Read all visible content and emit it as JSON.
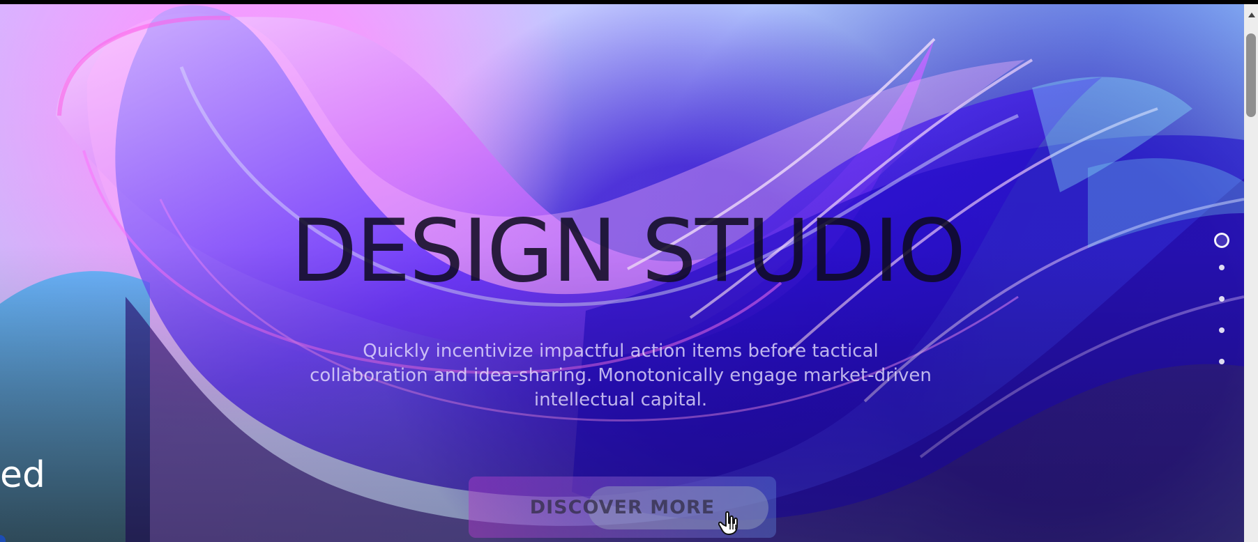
{
  "hero": {
    "title": "DESIGN STUDIO",
    "subtitle": "Quickly incentivize impactful action items before tactical collaboration and idea-sharing. Monotonically engage market-driven intellectual capital.",
    "cta_label": "DISCOVER MORE"
  },
  "sidebar": {
    "partial_text": "ed"
  },
  "slider": {
    "slide_count": 5,
    "active_index": 0
  },
  "colors": {
    "title": "#1a1230",
    "subtitle": "#ebe4ff",
    "cta_left": "#a93ac6",
    "cta_right": "#5a7ad0",
    "background_light": "#aecbff",
    "background_deep": "#300ad2"
  },
  "icons": {
    "pointer": "hand-pointer-icon",
    "scroll": "scroll-up-arrow-icon",
    "slides": "pagination-dot-icon"
  }
}
